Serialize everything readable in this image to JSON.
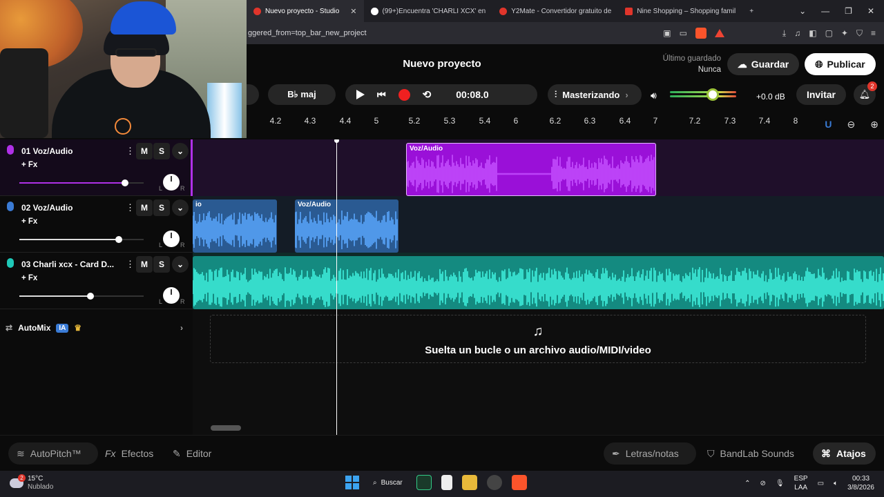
{
  "browser": {
    "tabs": [
      {
        "label": "Nuevo proyecto - Studio",
        "active": true,
        "color": "#e0352b"
      },
      {
        "label": "(99+)Encuentra 'CHARLI XCX' en",
        "active": false,
        "color": "#ffffff"
      },
      {
        "label": "Y2Mate - Convertidor gratuito de",
        "active": false,
        "color": "#e0352b"
      },
      {
        "label": "Nine Shopping – Shopping famil",
        "active": false,
        "color": "#e0352b"
      }
    ],
    "new_tab": "+",
    "url": "ggered_from=top_bar_new_project"
  },
  "header": {
    "title": "Nuevo proyecto",
    "last_saved_label": "Último guardado",
    "last_saved_value": "Nunca",
    "save_label": "Guardar",
    "publish_label": "Publicar"
  },
  "transport": {
    "key": "B♭ maj",
    "time": "00:08.0",
    "mastering": "Masterizando",
    "db": "+0.0 dB",
    "invite": "Invitar",
    "notifications": "2",
    "volume_level": 0.65
  },
  "ruler": {
    "ticks": [
      "4.2",
      "4.3",
      "4.4",
      "5",
      "5.2",
      "5.3",
      "5.4",
      "6",
      "6.2",
      "6.3",
      "6.4",
      "7",
      "7.2",
      "7.3",
      "7.4",
      "8"
    ]
  },
  "tracks": [
    {
      "number": "01",
      "name": "01  Voz/Audio",
      "fx": "+ Fx",
      "mute": "M",
      "solo": "S",
      "color": "#b030e8",
      "volume": 0.85,
      "l": "L",
      "r": "R"
    },
    {
      "number": "02",
      "name": "02  Voz/Audio",
      "fx": "+ Fx",
      "mute": "M",
      "solo": "S",
      "color": "#3a7bd5",
      "volume": 0.8,
      "l": "L",
      "r": "R"
    },
    {
      "number": "03",
      "name": "03  Charli xcx - Card D...",
      "fx": "+ Fx",
      "mute": "M",
      "solo": "S",
      "color": "#1fc9b8",
      "volume": 0.57,
      "l": "L",
      "r": "R"
    }
  ],
  "clips": {
    "track1": "Voz/Audio",
    "track2a": "io",
    "track2b": "Voz/Audio"
  },
  "automix": {
    "label": "AutoMix",
    "badge": "IA"
  },
  "dropzone": {
    "text": "Suelta un bucle o un archivo audio/MIDI/video"
  },
  "bottom": {
    "autopitch": "AutoPitch™",
    "effects": "Efectos",
    "editor": "Editor",
    "lyrics": "Letras/notas",
    "sounds": "BandLab Sounds",
    "shortcuts": "Atajos"
  },
  "taskbar": {
    "temp": "15°C",
    "weather": "Nublado",
    "weather_badge": "2",
    "search": "Buscar",
    "lang1": "ESP",
    "lang2": "LAA",
    "time": "00:33",
    "date": "3/8/2026"
  }
}
